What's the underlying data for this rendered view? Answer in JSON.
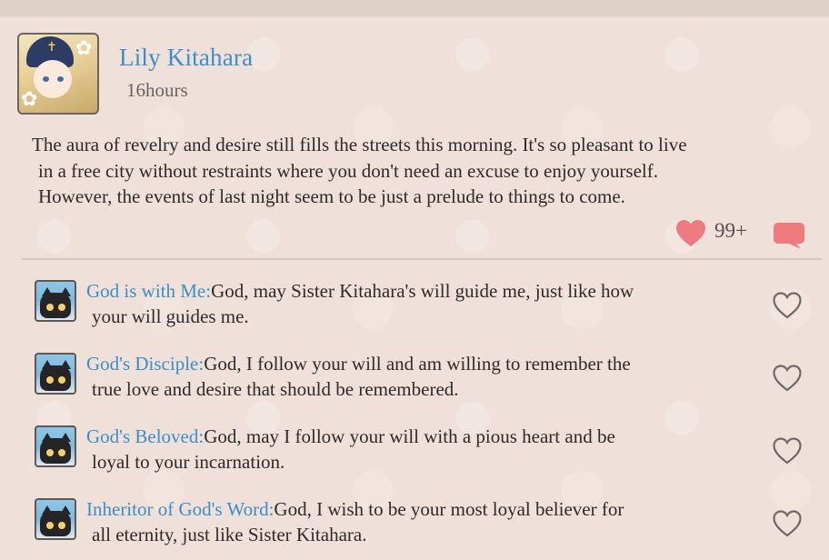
{
  "post": {
    "author": "Lily Kitahara",
    "time": "16hours",
    "text_lines": [
      "The aura of revelry and desire still fills the streets this morning. It's so pleasant to live",
      "in a free city without restraints where you don't need an excuse to enjoy yourself.",
      "However, the events of last night seem to be just a prelude to things to come."
    ],
    "like_count": "99+",
    "liked": true
  },
  "comments": [
    {
      "author": "God is with Me:",
      "line1": "God, may Sister Kitahara's will guide me, just like how",
      "line2": "your will guides me."
    },
    {
      "author": "God's Disciple:",
      "line1": "God, I follow your will and am willing to remember the",
      "line2": "true love and desire that should be remembered."
    },
    {
      "author": "God's Beloved:",
      "line1": "God, may I follow your will with a pious heart and be",
      "line2": "loyal to your incarnation."
    },
    {
      "author": "Inheritor of God's Word:",
      "line1": "God, I wish to be your most loyal believer for",
      "line2": "all eternity, just like Sister Kitahara."
    }
  ],
  "icons": {
    "like": "heart-filled-icon",
    "comment": "speech-bubble-icon",
    "comment_like": "heart-outline-icon"
  },
  "colors": {
    "background": "#efe1d9",
    "author_name": "#3b8ec7",
    "heart_filled": "#ee7a82",
    "comment_bubble": "#f07b7e",
    "heart_outline": "#6f6868"
  }
}
